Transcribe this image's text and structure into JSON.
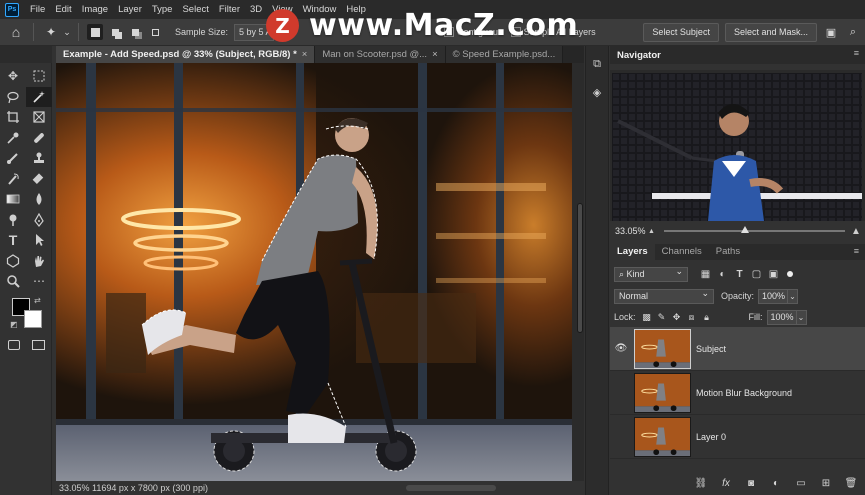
{
  "menu": {
    "logo": "Ps",
    "items": [
      "File",
      "Edit",
      "Image",
      "Layer",
      "Type",
      "Select",
      "Filter",
      "3D",
      "View",
      "Window",
      "Help"
    ]
  },
  "watermark": {
    "badge": "Z",
    "text": "www.MacZ.com"
  },
  "options": {
    "sample_size_label": "Sample Size:",
    "sample_size_value": "5 by 5 A",
    "contiguous": "Contiguous",
    "sample_all": "Sample All Layers",
    "select_subject": "Select Subject",
    "select_mask": "Select and Mask..."
  },
  "tabs": [
    {
      "label": "Example - Add Speed.psd @ 33% (Subject, RGB/8) *",
      "active": true
    },
    {
      "label": "Man on Scooter.psd @...",
      "active": false
    },
    {
      "label": "© Speed Example.psd...",
      "active": false
    }
  ],
  "status": {
    "text": "33.05%  11694 px x 7800 px (300 ppi)"
  },
  "navigator": {
    "title": "Navigator",
    "zoom": "33.05%",
    "zoom_fraction": 0.45
  },
  "layers_panel": {
    "tabs": [
      "Layers",
      "Channels",
      "Paths"
    ],
    "kind_label": "Kind",
    "blend_mode": "Normal",
    "opacity_label": "Opacity:",
    "opacity_value": "100%",
    "lock_label": "Lock:",
    "fill_label": "Fill:",
    "fill_value": "100%",
    "layers": [
      {
        "name": "Subject",
        "visible": true,
        "selected": true
      },
      {
        "name": "Motion Blur Background",
        "visible": false,
        "selected": false
      },
      {
        "name": "Layer 0",
        "visible": false,
        "selected": false
      }
    ]
  },
  "colors": {
    "accent": "#31a8ff",
    "foreground": "#000000",
    "background": "#ffffff",
    "watermark_red": "#d03a2c"
  }
}
